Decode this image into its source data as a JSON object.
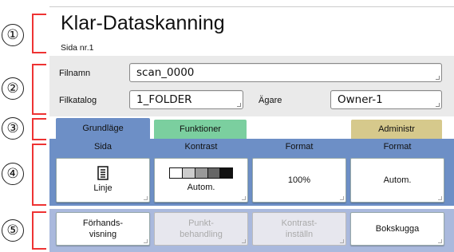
{
  "callouts": [
    "①",
    "②",
    "③",
    "④",
    "⑤"
  ],
  "header": {
    "title": "Klar-Dataskanning",
    "subtitle": "Sida nr.1"
  },
  "fields": {
    "filename_label": "Filnamn",
    "filename_value": "scan_0000",
    "folder_label": "Filkatalog",
    "folder_value": "1_FOLDER",
    "owner_label": "Ägare",
    "owner_value": "Owner-1"
  },
  "tabs": {
    "basic": "Grundläge",
    "functions": "Funktioner",
    "admin": "Administr"
  },
  "settings": {
    "page": {
      "header": "Sida",
      "label": "Linje",
      "icon": "document-icon"
    },
    "contrast": {
      "header": "Kontrast",
      "label": "Autom.",
      "icon": "contrast-scale-icon"
    },
    "format1": {
      "header": "Format",
      "label": "100%"
    },
    "format2": {
      "header": "Format",
      "label": "Autom."
    }
  },
  "actions": {
    "preview": "Förhands-\nvisning",
    "dot": "Punkt-\nbehandling",
    "contrast_adj": "Kontrast-\ninställn",
    "book_shadow": "Bokskugga"
  },
  "colors": {
    "accent_blue": "#6d8fc6",
    "tab_green": "#7bcf9f",
    "tab_admin": "#d6c98c",
    "action_bg": "#aab9dd",
    "callout_bracket": "#e33333"
  }
}
